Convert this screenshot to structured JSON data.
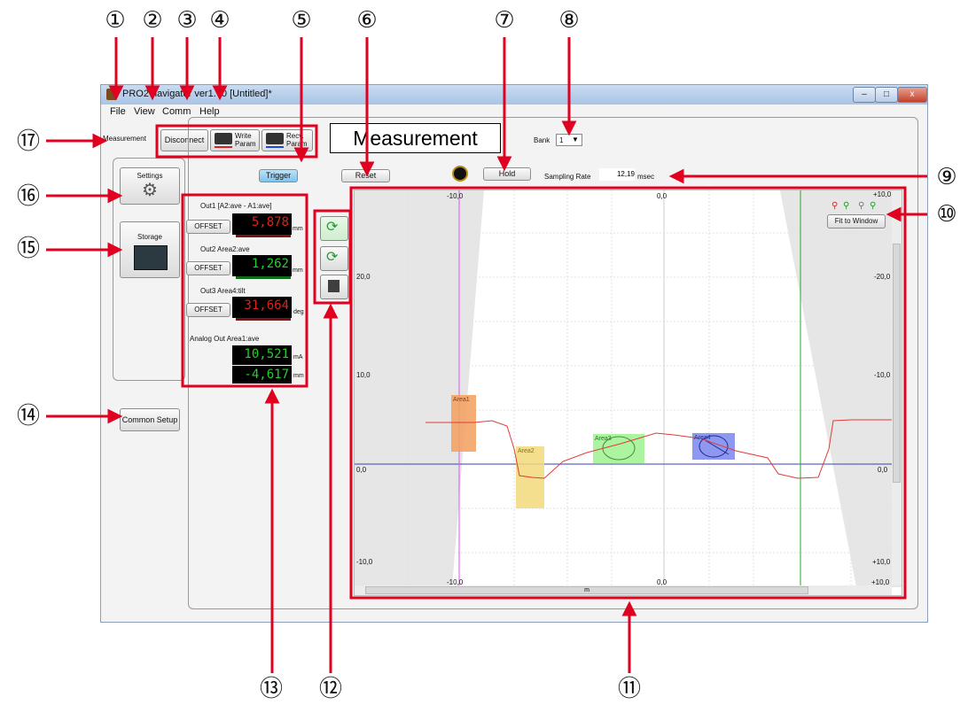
{
  "window": {
    "title": "PRO2 navigator ver1.70 [Untitled]*",
    "controls": [
      "–",
      "□",
      "x"
    ]
  },
  "menu": [
    "File",
    "View",
    "Comm",
    "Help"
  ],
  "toolbar": {
    "mode_label": "Measurement",
    "disconnect": "Disconnect",
    "write_param": "Write\nParam",
    "recv_param": "Recv.\nParam",
    "screen_title": "Measurement",
    "bank_label": "Bank",
    "bank_value": "1"
  },
  "sidebar": {
    "settings": "Settings",
    "storage": "Storage",
    "common_setup": "Common Setup"
  },
  "controls": {
    "trigger": "Trigger",
    "reset": "Reset",
    "hold": "Hold",
    "sampling_label": "Sampling Rate",
    "sampling_value": "12,19",
    "sampling_unit": "msec"
  },
  "outputs": {
    "out1_label": "Out1  [A2:ave - A1:ave]",
    "out1_value": "5,878",
    "out1_unit": "mm",
    "out2_label": "Out2  Area2:ave",
    "out2_value": "1,262",
    "out2_unit": "mm",
    "out3_label": "Out3  Area4:tilt",
    "out3_value": "31,664",
    "out3_unit": "deg",
    "offset": "OFFSET",
    "analog_label": "Analog Out  Area1:ave",
    "analog_ma": "10,521",
    "analog_ma_unit": "mA",
    "analog_mm": "-4,617",
    "analog_mm_unit": "mm",
    "colors": {
      "out1": "#e0201a",
      "out2": "#1fd12a",
      "out3": "#e0201a",
      "analog": "#1fd12a"
    }
  },
  "chart": {
    "fit_to_window": "Fit to Window",
    "top_ticks": [
      "-10,0",
      "0,0",
      "+10,0"
    ],
    "bottom_ticks": [
      "-10,0",
      "0,0",
      "+10,0"
    ],
    "left_ticks": [
      "20,0",
      "10,0",
      "0,0",
      "-10,0"
    ],
    "right_ticks": [
      "-20,0",
      "-10,0",
      "0,0",
      "+10,0"
    ],
    "areas": [
      "Area1",
      "Area2",
      "Area3",
      "Area4"
    ],
    "scroll_marker": "m"
  },
  "callouts": [
    "①",
    "②",
    "③",
    "④",
    "⑤",
    "⑥",
    "⑦",
    "⑧",
    "⑨",
    "⑩",
    "⑪",
    "⑫",
    "⑬",
    "⑭",
    "⑮",
    "⑯",
    "⑰"
  ],
  "colors": {
    "annotation": "#e00020",
    "titlebar": "#b8cfec",
    "lcd_bg": "#000000"
  }
}
